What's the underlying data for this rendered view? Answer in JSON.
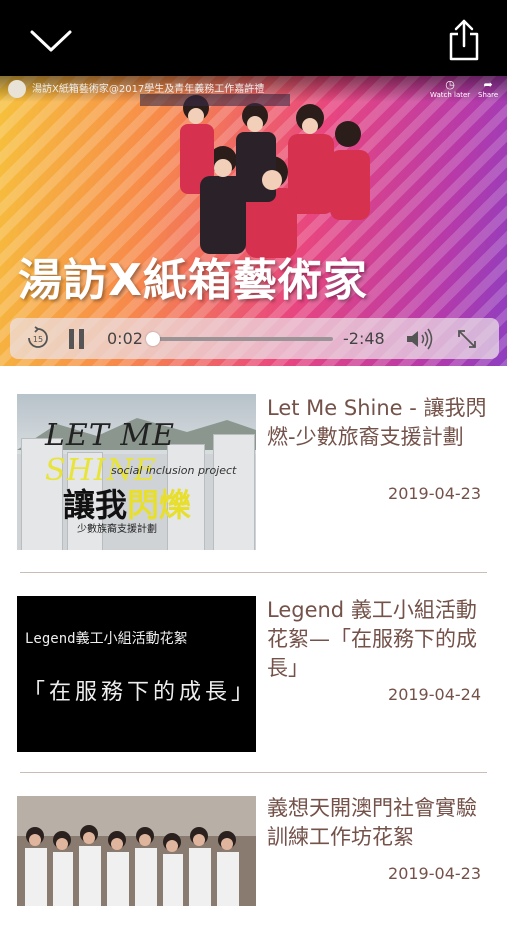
{
  "video": {
    "overlay_title": "湯訪X紙箱藝術家@2017學生及青年義務工作嘉許禮",
    "watch_later": "Watch later",
    "share": "Share",
    "big_title": "湯訪X紙箱藝術家",
    "current_time": "0:02",
    "remaining_time": "-2:48",
    "progress": 0.01
  },
  "items": [
    {
      "title": "Let Me Shine - 讓我閃燃-少數旅裔支援計劃",
      "date": "2019-04-23",
      "thumb": {
        "line1_a": "LET ME ",
        "line1_b": "SHINE",
        "line2": "social inclusion project",
        "line3_a": "讓我",
        "line3_b": "閃爍",
        "line4": "少數族裔支援計劃"
      }
    },
    {
      "title": "Legend 義工小組活動花絮—「在服務下的成長」",
      "date": "2019-04-24",
      "thumb": {
        "line1": "Legend義工小組活動花絮",
        "line2": "「在服務下的成長」"
      }
    },
    {
      "title": "義想天開澳門社會實驗訓練工作坊花絮",
      "date": "2019-04-23"
    }
  ],
  "colors": {
    "accent_text": "#74524a",
    "top_bar": "#000000"
  }
}
